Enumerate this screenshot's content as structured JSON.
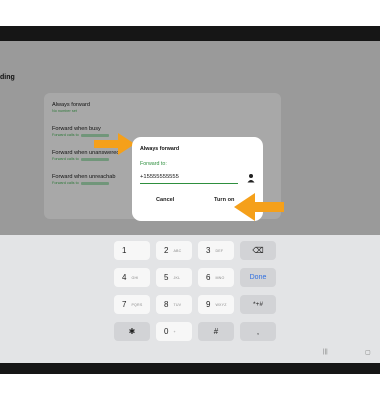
{
  "page": {
    "title": "ding"
  },
  "settings": {
    "items": [
      {
        "label": "Always forward",
        "sub": "No number set"
      },
      {
        "label": "Forward when busy",
        "sub": "Forward calls to"
      },
      {
        "label": "Forward when unanswered",
        "sub": "Forward calls to"
      },
      {
        "label": "Forward when unreachab",
        "sub": "Forward calls to"
      }
    ]
  },
  "dialog": {
    "title": "Always forward",
    "field_label": "Forward to:",
    "input_value": "+15555555555",
    "cancel_label": "Cancel",
    "confirm_label": "Turn on",
    "contact_icon": "contact-person-icon"
  },
  "keyboard": {
    "keys": [
      {
        "main": "1",
        "sub": ""
      },
      {
        "main": "2",
        "sub": "ABC"
      },
      {
        "main": "3",
        "sub": "DEF"
      },
      {
        "main": "⌫",
        "sub": ""
      },
      {
        "main": "4",
        "sub": "GHI"
      },
      {
        "main": "5",
        "sub": "JKL"
      },
      {
        "main": "6",
        "sub": "MNO"
      },
      {
        "main": "Done",
        "sub": ""
      },
      {
        "main": "7",
        "sub": "PQRS"
      },
      {
        "main": "8",
        "sub": "TUV"
      },
      {
        "main": "9",
        "sub": "WXYZ"
      },
      {
        "main": "*+#",
        "sub": ""
      },
      {
        "main": "✱",
        "sub": ""
      },
      {
        "main": "0",
        "sub": "+"
      },
      {
        "main": "#",
        "sub": ""
      },
      {
        "main": ",",
        "sub": ""
      }
    ]
  },
  "navbar": {
    "recents": "|||",
    "home": "▢"
  },
  "colors": {
    "accent_green": "#2e8f3e",
    "arrow_orange": "#f5a01a",
    "done_blue": "#2f6fe0"
  }
}
